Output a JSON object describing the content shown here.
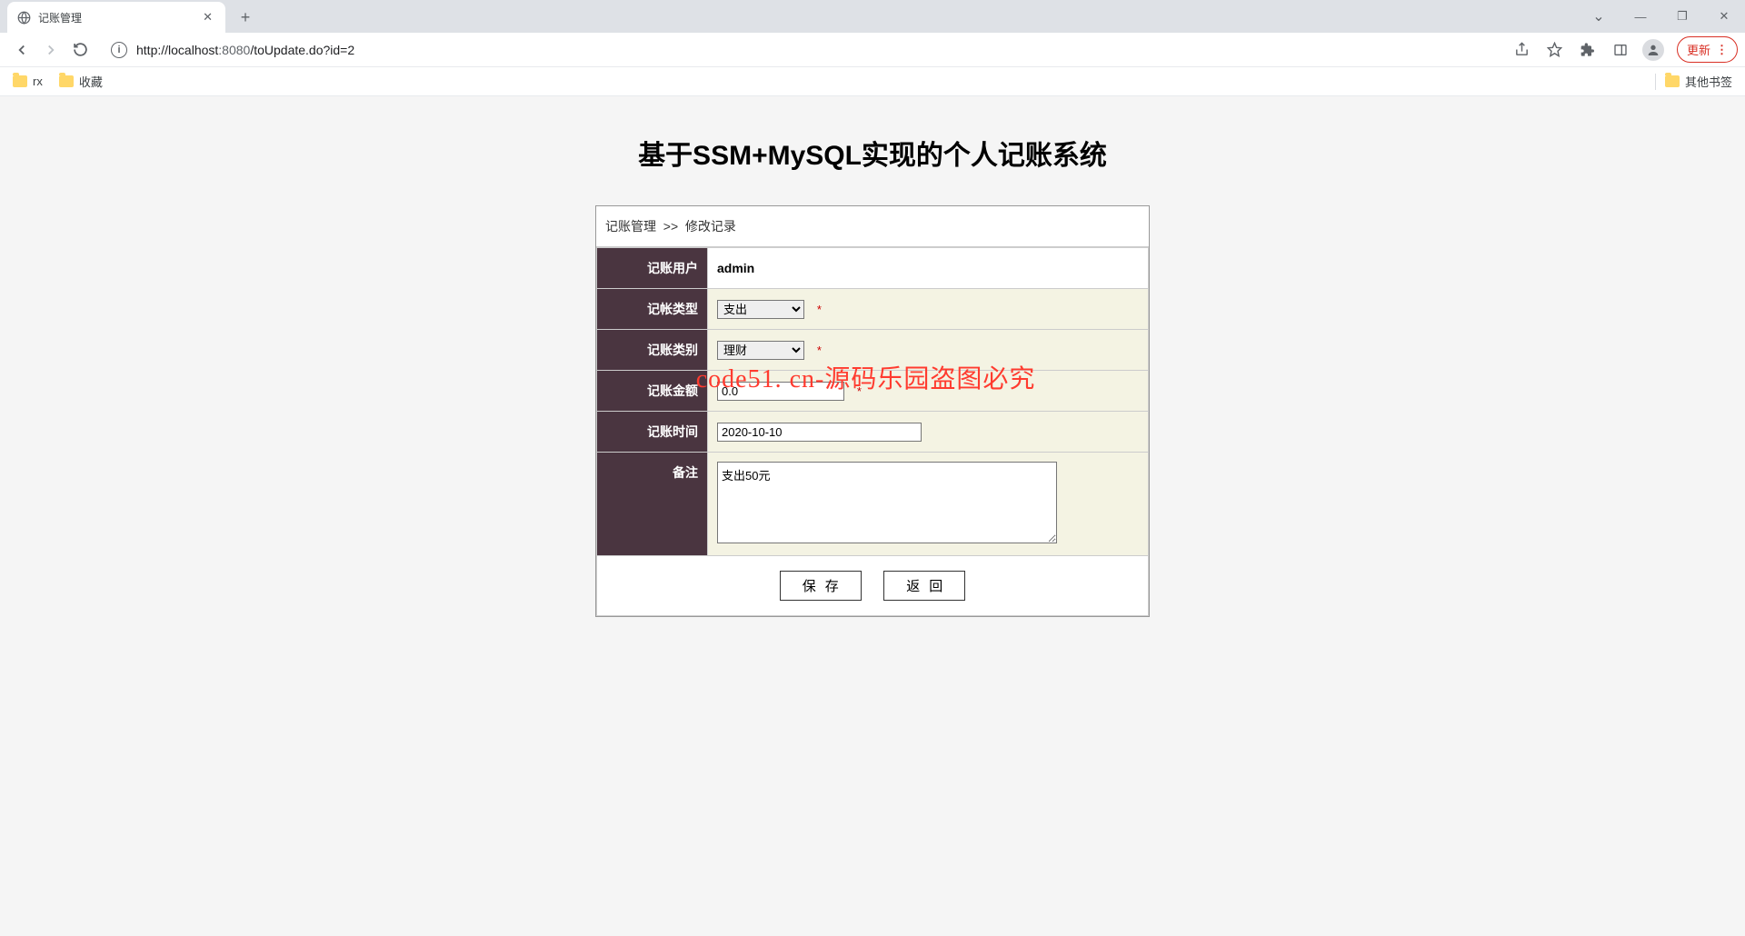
{
  "browser": {
    "tab_title": "记账管理",
    "url_host": "http://localhost",
    "url_port": ":8080",
    "url_path": "/toUpdate.do?id=2",
    "update_label": "更新",
    "bookmarks": {
      "rx": "rx",
      "favorites": "收藏",
      "other": "其他书签"
    }
  },
  "page": {
    "title": "基于SSM+MySQL实现的个人记账系统",
    "breadcrumb_root": "记账管理",
    "breadcrumb_sep": ">>",
    "breadcrumb_current": "修改记录",
    "labels": {
      "user": "记账用户",
      "type": "记帐类型",
      "category": "记账类别",
      "amount": "记账金额",
      "date": "记账时间",
      "remark": "备注"
    },
    "values": {
      "user": "admin",
      "type_selected": "支出",
      "category_selected": "理财",
      "amount": "0.0",
      "date": "2020-10-10",
      "remark": "支出50元"
    },
    "required_mark": "*",
    "buttons": {
      "save": "保存",
      "back": "返回"
    }
  },
  "watermark": "code51. cn-源码乐园盗图必究"
}
